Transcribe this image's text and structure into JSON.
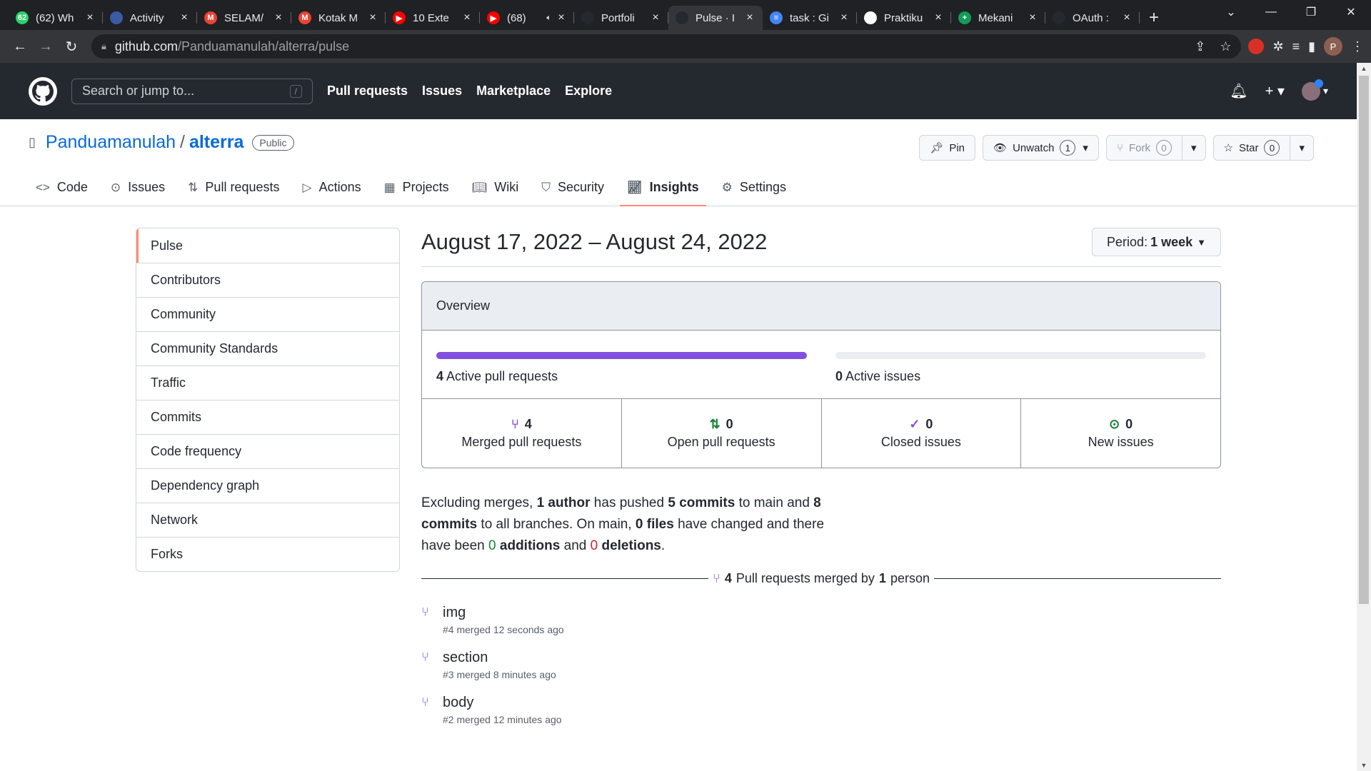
{
  "browser": {
    "tabs": [
      {
        "title": "(62) Wh",
        "color": "#25d366",
        "glyph": "62"
      },
      {
        "title": "Activity",
        "color": "#3b5ba5",
        "glyph": ""
      },
      {
        "title": "SELAM/",
        "color": "#ea4335",
        "glyph": "M"
      },
      {
        "title": "Kotak M",
        "color": "#ea4335",
        "glyph": "M"
      },
      {
        "title": "10 Exte",
        "color": "#ff0000",
        "glyph": "▶"
      },
      {
        "title": "(68)",
        "color": "#ff0000",
        "glyph": "▶",
        "sound": true
      },
      {
        "title": "Portfoli",
        "color": "#24292f",
        "glyph": ""
      },
      {
        "title": "Pulse · I",
        "color": "#24292f",
        "glyph": "",
        "active": true
      },
      {
        "title": "task : Gi",
        "color": "#4285f4",
        "glyph": "≡"
      },
      {
        "title": "Praktiku",
        "color": "#ffffff",
        "glyph": ""
      },
      {
        "title": "Mekani",
        "color": "#0f9d58",
        "glyph": "+"
      },
      {
        "title": "OAuth :",
        "color": "#24292f",
        "glyph": ""
      }
    ],
    "url_host": "github.com",
    "url_path": "/Panduamanulah/alterra/pulse",
    "profile_letter": "P"
  },
  "gh": {
    "search_placeholder": "Search or jump to...",
    "search_kbd": "/",
    "nav": [
      "Pull requests",
      "Issues",
      "Marketplace",
      "Explore"
    ]
  },
  "repo": {
    "owner": "Panduamanulah",
    "name": "alterra",
    "visibility": "Public",
    "pin_label": "Pin",
    "unwatch_label": "Unwatch",
    "unwatch_count": "1",
    "fork_label": "Fork",
    "fork_count": "0",
    "star_label": "Star",
    "star_count": "0"
  },
  "reponav": [
    "Code",
    "Issues",
    "Pull requests",
    "Actions",
    "Projects",
    "Wiki",
    "Security",
    "Insights",
    "Settings"
  ],
  "sidemenu": [
    "Pulse",
    "Contributors",
    "Community",
    "Community Standards",
    "Traffic",
    "Commits",
    "Code frequency",
    "Dependency graph",
    "Network",
    "Forks"
  ],
  "pulse": {
    "date_range": "August 17, 2022 – August 24, 2022",
    "period_label": "Period:",
    "period_value": "1 week",
    "overview_title": "Overview",
    "active_prs_count": "4",
    "active_prs_label": "Active pull requests",
    "active_prs_fill_fraction": 1.0,
    "active_issues_count": "0",
    "active_issues_label": "Active issues",
    "active_issues_fill_fraction": 0.0,
    "merged_count": "4",
    "merged_label": "Merged pull requests",
    "open_count": "0",
    "open_label": "Open pull requests",
    "closed_count": "0",
    "closed_label": "Closed issues",
    "new_count": "0",
    "new_label": "New issues",
    "summary": {
      "authors": "1 author",
      "commits_main": "5 commits",
      "commits_all": "8 commits",
      "files": "0 files",
      "additions_n": "0",
      "additions": "additions",
      "deletions_n": "0",
      "deletions": "deletions"
    },
    "merged_divider_count": "4",
    "merged_divider_text": "Pull requests merged by",
    "merged_divider_people": "1",
    "merged_divider_suffix": "person",
    "merged_prs": [
      {
        "title": "img",
        "meta": "#4 merged 12 seconds ago"
      },
      {
        "title": "section",
        "meta": "#3 merged 8 minutes ago"
      },
      {
        "title": "body",
        "meta": "#2 merged 12 minutes ago"
      }
    ]
  },
  "colors": {
    "accent_underline": "#fd8c73",
    "merged_purple": "#8250df",
    "additions": "#1a7f37",
    "deletions": "#cf222e"
  }
}
